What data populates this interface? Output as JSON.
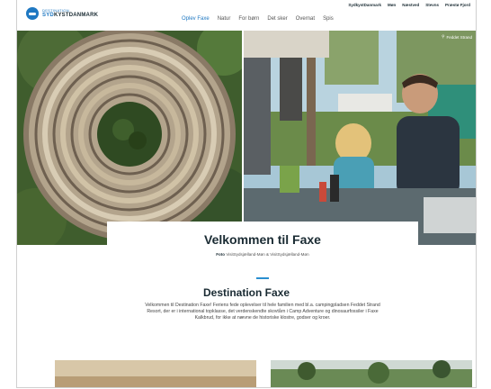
{
  "header": {
    "logo_small": "DESTINATION",
    "logo_big_a": "SYD",
    "logo_big_b": "KYSTDANMARK",
    "util_nav": [
      "SydkystDanmark",
      "Møn",
      "Næstved",
      "Stevns",
      "Præstø Fjord"
    ],
    "main_nav": [
      {
        "label": "Oplev Faxe",
        "active": true
      },
      {
        "label": "Natur",
        "active": false
      },
      {
        "label": "For børn",
        "active": false
      },
      {
        "label": "Det sker",
        "active": false
      },
      {
        "label": "Overnat",
        "active": false
      },
      {
        "label": "Spis",
        "active": false
      }
    ]
  },
  "hero": {
    "caption": "Feddet Strand"
  },
  "welcome": {
    "title": "Velkommen til Faxe",
    "credit_label": "Foto",
    "credit_text": "VisitSydsjælland-Møn & VisitSydsjælland-Møn"
  },
  "destination": {
    "title": "Destination Faxe",
    "intro": "Velkommen til Destination Faxe! Feriens fede oplevelser til hele familien med bl.a. campingpladsen Feddet Strand Resort, der er i international topklasse, det verdenskendte skovtårn i Camp Adventure og dinosaurfossiler i Faxe Kalkbrud, for ikke at nævne de historiske klostre, godser og kroer."
  },
  "colors": {
    "brand": "#1f78c2",
    "accent": "#2a8fd0",
    "text": "#1a2b33"
  }
}
